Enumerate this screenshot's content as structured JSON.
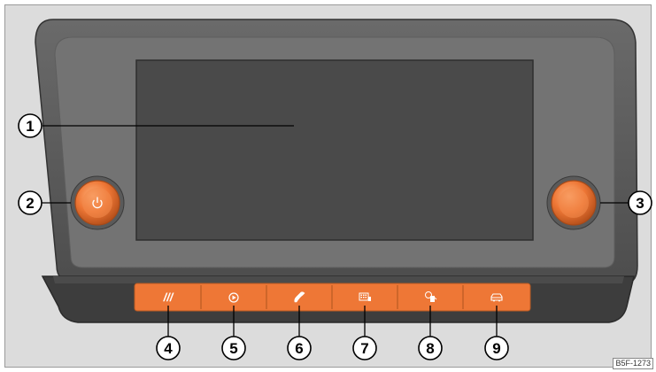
{
  "figure": {
    "reference_code": "B5F-1273",
    "colors": {
      "background": "#dcdcdc",
      "bezel_outer": "#595959",
      "bezel_inner": "#6e6e6e",
      "bezel_lower": "#3f3f3f",
      "screen": "#4a4a4a",
      "accent": "#ee7736",
      "callout": "#ffffff"
    }
  },
  "callouts": [
    {
      "number": "1",
      "target": "screen"
    },
    {
      "number": "2",
      "target": "power-volume-knob"
    },
    {
      "number": "3",
      "target": "setting-knob"
    },
    {
      "number": "4",
      "target": "button-menu"
    },
    {
      "number": "5",
      "target": "button-media"
    },
    {
      "number": "6",
      "target": "button-phone"
    },
    {
      "number": "7",
      "target": "button-navigation"
    },
    {
      "number": "8",
      "target": "button-fuel"
    },
    {
      "number": "9",
      "target": "button-car"
    }
  ],
  "buttons": [
    {
      "label": "///",
      "icon": "menu-slashes-icon"
    },
    {
      "label": "",
      "icon": "play-icon"
    },
    {
      "label": "",
      "icon": "phone-handset-icon"
    },
    {
      "label": "",
      "icon": "navigation-card-icon"
    },
    {
      "label": "",
      "icon": "fuel-pump-icon"
    },
    {
      "label": "",
      "icon": "car-icon"
    }
  ],
  "knobs": [
    {
      "side": "left",
      "icon": "power-icon"
    },
    {
      "side": "right",
      "icon": ""
    }
  ]
}
